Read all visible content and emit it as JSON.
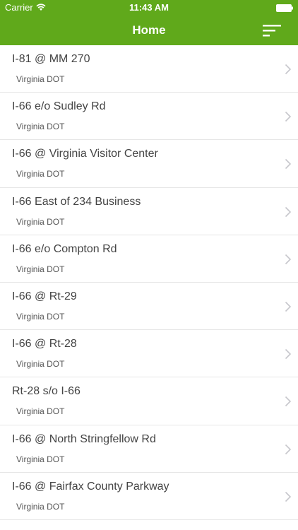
{
  "status_bar": {
    "carrier": "Carrier",
    "time": "11:43 AM"
  },
  "navbar": {
    "title": "Home",
    "menu_icon": "sort-menu-icon"
  },
  "colors": {
    "header_green": "#60a91b",
    "title_text": "#444444",
    "subtitle_text": "#555555"
  },
  "cameras": [
    {
      "title": "I-81 @ MM 270",
      "source": "Virginia DOT"
    },
    {
      "title": "I-66 e/o Sudley Rd",
      "source": "Virginia DOT"
    },
    {
      "title": "I-66 @ Virginia Visitor Center",
      "source": "Virginia DOT"
    },
    {
      "title": "I-66 East of 234 Business",
      "source": "Virginia DOT"
    },
    {
      "title": "I-66 e/o Compton Rd",
      "source": "Virginia DOT"
    },
    {
      "title": "I-66 @ Rt-29",
      "source": "Virginia DOT"
    },
    {
      "title": "I-66 @ Rt-28",
      "source": "Virginia DOT"
    },
    {
      "title": "Rt-28 s/o I-66",
      "source": "Virginia DOT"
    },
    {
      "title": "I-66 @ North Stringfellow Rd",
      "source": "Virginia DOT"
    },
    {
      "title": "I-66 @ Fairfax County Parkway",
      "source": "Virginia DOT"
    }
  ]
}
